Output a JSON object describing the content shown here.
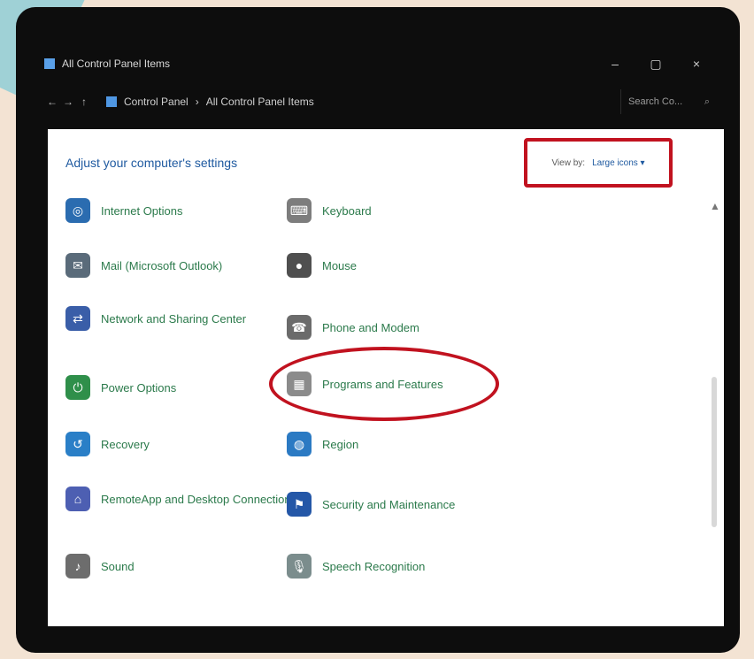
{
  "window": {
    "title": "All Control Panel Items",
    "controls": {
      "minimize": "–",
      "maximize": "▢",
      "close": "×"
    }
  },
  "address": {
    "back": "←",
    "forward": "→",
    "up_label": "↑",
    "breadcrumb": [
      "Control Panel",
      "All Control Panel Items"
    ],
    "search_placeholder": "Search Co..."
  },
  "content": {
    "heading": "Adjust your computer's settings",
    "view_by_label": "View by:",
    "view_by_value": "Large icons ▾",
    "left_items": [
      {
        "label": "Internet Options",
        "icon": "globe-icon",
        "color": "#2b6cb0"
      },
      {
        "label": "Mail (Microsoft Outlook)",
        "icon": "mail-icon",
        "color": "#5a6b7a"
      },
      {
        "label": "Network and Sharing Center",
        "icon": "network-icon",
        "color": "#3a5ea8"
      },
      {
        "label": "Power Options",
        "icon": "power-icon",
        "color": "#2f8f4a"
      },
      {
        "label": "Recovery",
        "icon": "recovery-icon",
        "color": "#2a7fc7"
      },
      {
        "label": "RemoteApp and Desktop Connections",
        "icon": "remote-icon",
        "color": "#4d5fb2"
      },
      {
        "label": "Sound",
        "icon": "sound-icon",
        "color": "#6d6d6d"
      }
    ],
    "right_items": [
      {
        "label": "Keyboard",
        "icon": "keyboard-icon",
        "color": "#7d7d7d"
      },
      {
        "label": "Mouse",
        "icon": "mouse-icon",
        "color": "#4f4f4f"
      },
      {
        "label": "Phone and Modem",
        "icon": "phone-icon",
        "color": "#6b6b6b"
      },
      {
        "label": "Programs and Features",
        "icon": "programs-icon",
        "color": "#8b8b8b"
      },
      {
        "label": "Region",
        "icon": "region-icon",
        "color": "#2b7ac3"
      },
      {
        "label": "Security and Maintenance",
        "icon": "security-icon",
        "color": "#2457a7"
      },
      {
        "label": "Speech Recognition",
        "icon": "microphone-icon",
        "color": "#7b8d8d"
      }
    ]
  }
}
